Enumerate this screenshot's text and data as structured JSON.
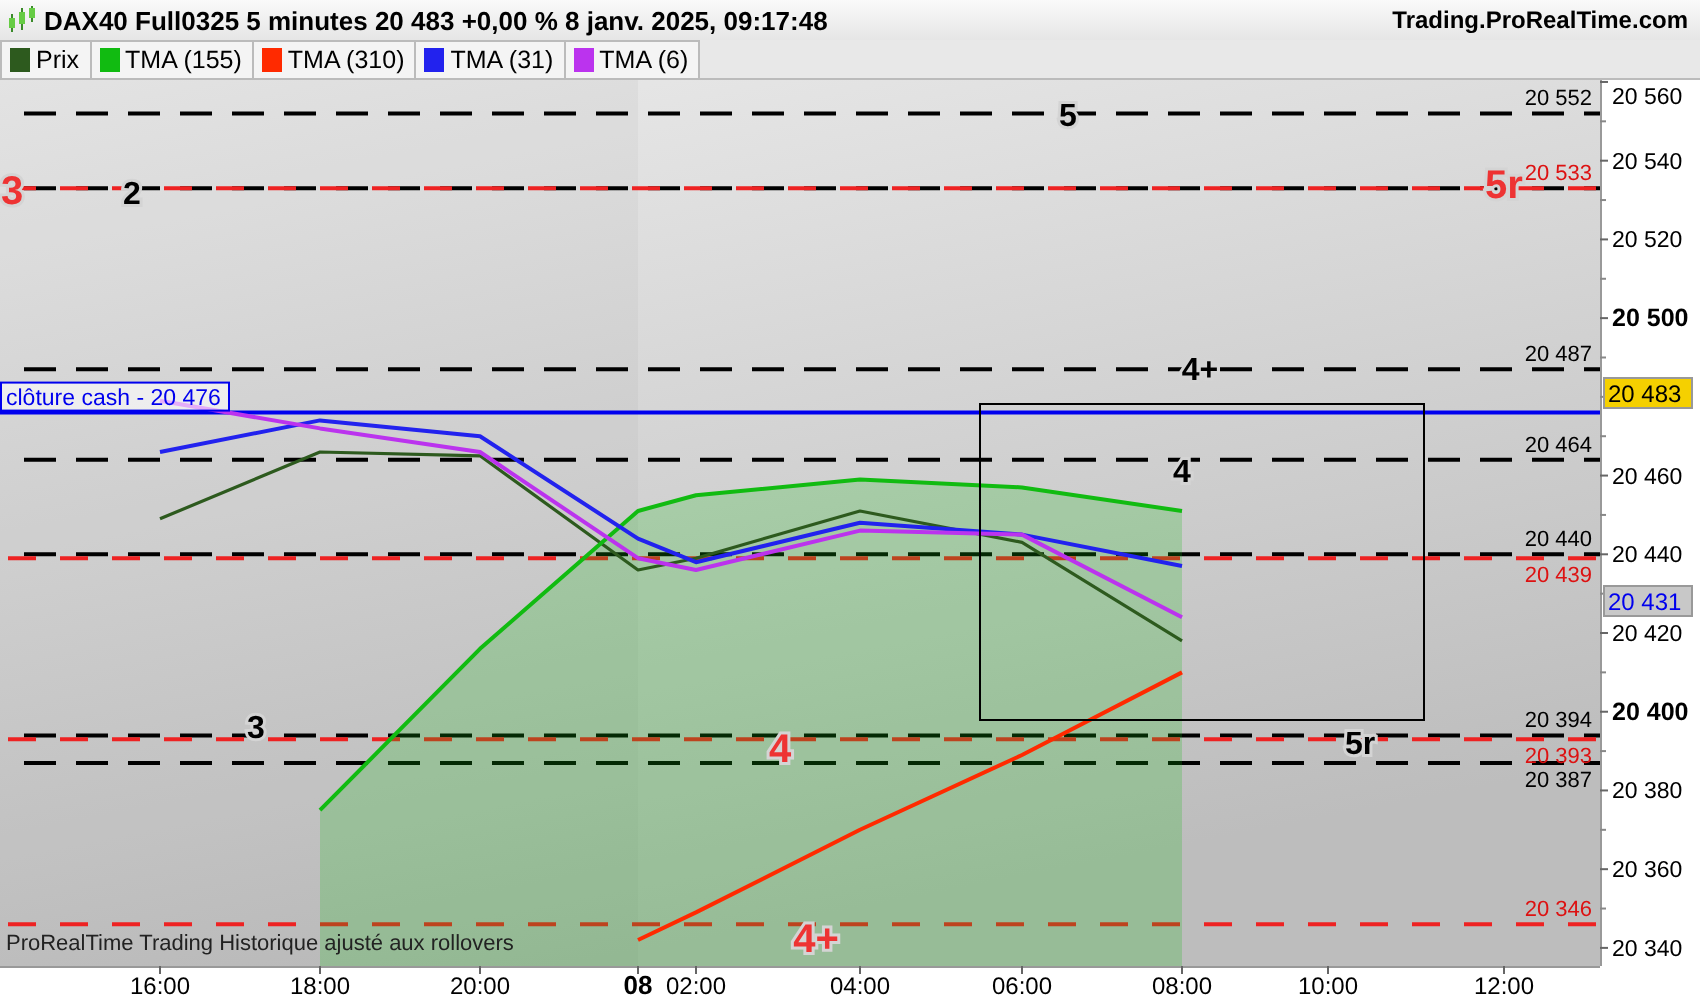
{
  "header": {
    "title": "DAX40 Full0325 5 minutes 20 483 +0,00 % 8 janv. 2025, 09:17:48",
    "site": "Trading.ProRealTime.com"
  },
  "chart": {
    "chart_data": {
      "type": "line",
      "categories": [
        "16:00",
        "18:00",
        "20:00",
        "08",
        "02:00",
        "04:00",
        "06:00",
        "08:00",
        "10:00",
        "12:00"
      ],
      "series": [
        {
          "name": "Prix",
          "color": "#2d5a1e",
          "values": [
            20449,
            20466,
            20465,
            20436,
            20439,
            20451,
            20443,
            20418,
            null,
            null
          ]
        },
        {
          "name": "TMA (155)",
          "type": "area",
          "color": "#11bb11",
          "values": [
            null,
            20375,
            20416,
            20451,
            20455,
            20459,
            20457,
            20451,
            null,
            null
          ]
        },
        {
          "name": "TMA (310)",
          "color": "#ff2a00",
          "values": [
            null,
            null,
            null,
            20342,
            20349,
            20370,
            20389,
            20410,
            null,
            null
          ]
        },
        {
          "name": "TMA (31)",
          "color": "#2222ee",
          "values": [
            20466,
            20474,
            20470,
            20444,
            20438,
            20448,
            20445,
            20437,
            null,
            null
          ]
        },
        {
          "name": "TMA (6)",
          "color": "#bb33ee",
          "values": [
            20479,
            20472,
            20466,
            20439,
            20436,
            20446,
            20445,
            20424,
            null,
            null
          ]
        }
      ],
      "ylim": [
        20335.4,
        20560.5
      ],
      "yticks": [
        {
          "value": 20340,
          "label": "20 340"
        },
        {
          "value": 20360,
          "label": "20 360"
        },
        {
          "value": 20380,
          "label": "20 380"
        },
        {
          "value": 20400,
          "label": "20 400"
        },
        {
          "value": 20420,
          "label": "20 420"
        },
        {
          "value": 20440,
          "label": "20 440"
        },
        {
          "value": 20460,
          "label": "20 460"
        },
        {
          "value": 20500,
          "label": "20 500"
        },
        {
          "value": 20520,
          "label": "20 520"
        },
        {
          "value": 20540,
          "label": "20 540"
        },
        {
          "value": 20560,
          "label": "20 560"
        }
      ],
      "ref_lines": [
        {
          "axis": "y",
          "value": 20552,
          "color": "#000000",
          "label": "20 552"
        },
        {
          "axis": "y",
          "value": 20533,
          "color": "#000000"
        },
        {
          "axis": "y",
          "value": 20533,
          "color": "#ee2222",
          "label": "20 533"
        },
        {
          "axis": "y",
          "value": 20487,
          "color": "#000000",
          "label": "20 487"
        },
        {
          "axis": "y",
          "value": 20476,
          "color": "#0000ee",
          "label": "clôture cash -  20 476"
        },
        {
          "axis": "y",
          "value": 20464,
          "color": "#000000",
          "label": "20 464"
        },
        {
          "axis": "y",
          "value": 20440,
          "color": "#000000",
          "label": "20 440"
        },
        {
          "axis": "y",
          "value": 20439,
          "color": "#ee2222",
          "label": "20 439"
        },
        {
          "axis": "y",
          "value": 20394,
          "color": "#000000",
          "label": "20 394"
        },
        {
          "axis": "y",
          "value": 20393,
          "color": "#ee2222",
          "label": "20 393"
        },
        {
          "axis": "y",
          "value": 20387,
          "color": "#000000",
          "label": "20 387"
        },
        {
          "axis": "y",
          "value": 20346,
          "color": "#ee2222",
          "label": "20 346"
        }
      ]
    },
    "marks": [
      {
        "text": "5",
        "color": "#000000"
      },
      {
        "text": "3",
        "color": "#ee3333"
      },
      {
        "text": "2",
        "color": "#000000"
      },
      {
        "text": "5r",
        "color": "#ee3333"
      },
      {
        "text": "4+",
        "color": "#000000"
      },
      {
        "text": "4",
        "color": "#000000"
      },
      {
        "text": "3",
        "color": "#000000"
      },
      {
        "text": "4",
        "color": "#ee3333"
      },
      {
        "text": "5r",
        "color": "#000000"
      },
      {
        "text": "4+",
        "color": "#ee3333"
      }
    ],
    "price_tags": [
      {
        "text": "20 483",
        "color": "#f5d000"
      },
      {
        "text": "20 431",
        "color": "#0000ee"
      }
    ],
    "footer_note": "ProRealTime Trading  Historique ajusté aux rollovers"
  }
}
